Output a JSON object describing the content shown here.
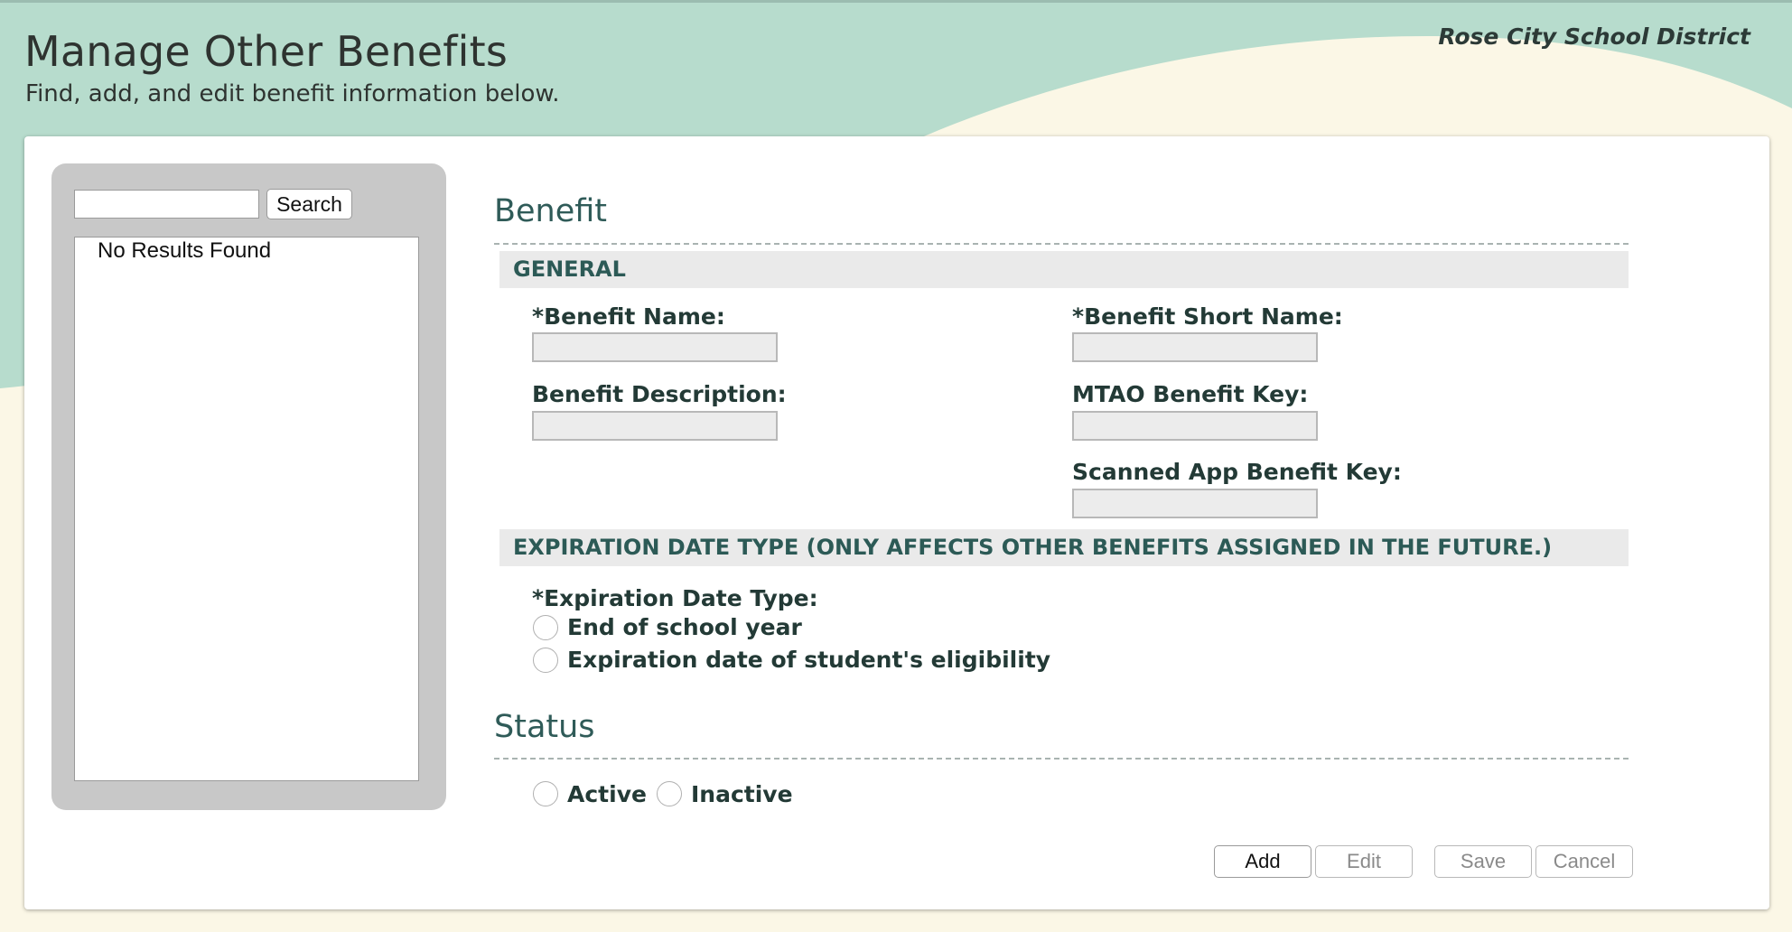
{
  "header": {
    "title": "Manage Other Benefits",
    "subtitle": "Find, add, and edit benefit information below.",
    "district": "Rose City School District"
  },
  "colors": {
    "banner": "#b7dccd",
    "background": "#fbf7e6",
    "heading_teal": "#2f5b58"
  },
  "sidebar": {
    "search_value": "",
    "search_button": "Search",
    "results_text": "No Results Found"
  },
  "benefit": {
    "section_title": "Benefit",
    "general_heading": "GENERAL",
    "fields": {
      "benefit_name": {
        "label": "*Benefit Name:",
        "value": ""
      },
      "benefit_short_name": {
        "label": "*Benefit Short Name:",
        "value": ""
      },
      "benefit_description": {
        "label": "Benefit Description:",
        "value": ""
      },
      "mtao_benefit_key": {
        "label": "MTAO Benefit Key:",
        "value": ""
      },
      "scanned_app_benefit_key": {
        "label": "Scanned App Benefit Key:",
        "value": ""
      }
    },
    "expiration_heading": "EXPIRATION DATE TYPE (ONLY AFFECTS OTHER BENEFITS ASSIGNED IN THE FUTURE.)",
    "expiration_label": "*Expiration Date Type:",
    "expiration_options": [
      "End of school year",
      "Expiration date of student's eligibility"
    ]
  },
  "status": {
    "section_title": "Status",
    "options": [
      "Active",
      "Inactive"
    ]
  },
  "actions": {
    "add": "Add",
    "edit": "Edit",
    "save": "Save",
    "cancel": "Cancel"
  }
}
